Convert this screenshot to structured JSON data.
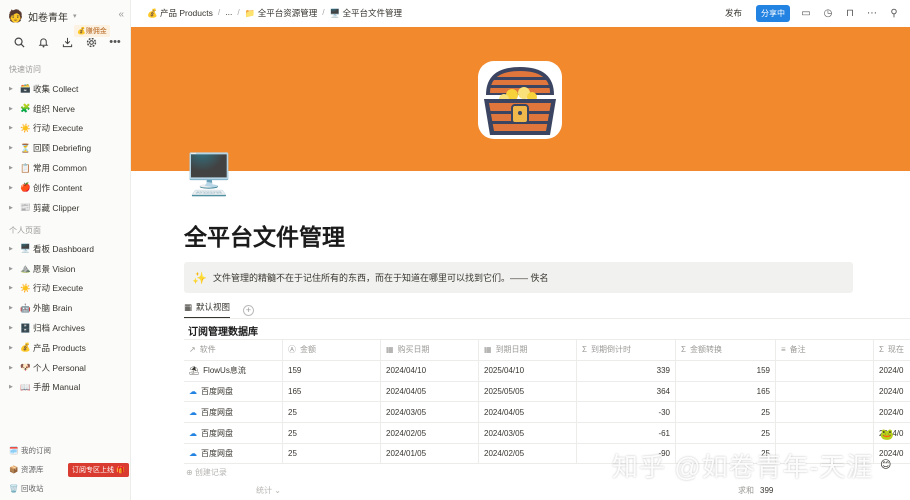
{
  "sidebar": {
    "workspace": {
      "avatar": "🧑",
      "name": "如卷青年"
    },
    "earn_badge": "💰赚佣金",
    "tools": [
      "search-icon",
      "bell-icon",
      "download-icon",
      "gear-icon",
      "more-icon"
    ],
    "section_quick": "快速访问",
    "quick": [
      {
        "icon": "🗃️",
        "label": "收集 Collect"
      },
      {
        "icon": "🧩",
        "label": "组织 Nerve"
      },
      {
        "icon": "☀️",
        "label": "行动 Execute"
      },
      {
        "icon": "⏳",
        "label": "回顾 Debriefing"
      },
      {
        "icon": "📋",
        "label": "常用 Common"
      },
      {
        "icon": "🍎",
        "label": "创作 Content"
      },
      {
        "icon": "📰",
        "label": "剪藏 Clipper"
      }
    ],
    "section_personal": "个人页面",
    "personal": [
      {
        "icon": "🖥️",
        "label": "看板 Dashboard"
      },
      {
        "icon": "⛰️",
        "label": "愿景 Vision"
      },
      {
        "icon": "☀️",
        "label": "行动 Execute"
      },
      {
        "icon": "🤖",
        "label": "外脑 Brain"
      },
      {
        "icon": "🗄️",
        "label": "归档 Archives"
      },
      {
        "icon": "💰",
        "label": "产品 Products"
      },
      {
        "icon": "🐶",
        "label": "个人 Personal"
      },
      {
        "icon": "📖",
        "label": "手册 Manual"
      }
    ],
    "footer": [
      {
        "icon": "🗓️",
        "label": "我的订阅"
      },
      {
        "icon": "📦",
        "label": "资源库"
      },
      {
        "icon": "🗑️",
        "label": "回收站"
      }
    ],
    "online_badge": "订阅专区上线 🎁"
  },
  "topbar": {
    "crumbs": [
      {
        "icon": "💰",
        "label": "产品 Products"
      },
      {
        "icon": "",
        "label": "..."
      },
      {
        "icon": "📁",
        "label": "全平台资源管理"
      },
      {
        "icon": "🖥️",
        "label": "全平台文件管理"
      }
    ],
    "publish": "发布",
    "share": "分享中"
  },
  "page": {
    "icon": "🖥️",
    "title": "全平台文件管理",
    "callout_icon": "✨",
    "callout": "文件管理的精髓不在于记住所有的东西，而在于知道在哪里可以找到它们。—— 佚名",
    "view_tab": "默认视图",
    "db_title": "订阅管理数据库"
  },
  "table": {
    "headers": [
      {
        "icon": "↗",
        "label": "软件"
      },
      {
        "icon": "Ⓐ",
        "label": "金额"
      },
      {
        "icon": "▦",
        "label": "购买日期"
      },
      {
        "icon": "▦",
        "label": "到期日期"
      },
      {
        "icon": "Σ",
        "label": "到期倒计时"
      },
      {
        "icon": "Σ",
        "label": "金额转换"
      },
      {
        "icon": "≡",
        "label": "备注"
      },
      {
        "icon": "Σ",
        "label": "现在"
      }
    ],
    "rows": [
      {
        "app": "FlowUs息流",
        "app_icon": "flowus",
        "amount": "159",
        "buy": "2024/04/10",
        "due": "2025/04/10",
        "countdown": "339",
        "convert": "159",
        "note": "",
        "now": "2024/0"
      },
      {
        "app": "百度网盘",
        "app_icon": "baidu",
        "amount": "165",
        "buy": "2024/04/05",
        "due": "2025/05/05",
        "countdown": "364",
        "convert": "165",
        "note": "",
        "now": "2024/0"
      },
      {
        "app": "百度网盘",
        "app_icon": "baidu",
        "amount": "25",
        "buy": "2024/03/05",
        "due": "2024/04/05",
        "countdown": "-30",
        "convert": "25",
        "note": "",
        "now": "2024/0"
      },
      {
        "app": "百度网盘",
        "app_icon": "baidu",
        "amount": "25",
        "buy": "2024/02/05",
        "due": "2024/03/05",
        "countdown": "-61",
        "convert": "25",
        "note": "",
        "now": "2024/0"
      },
      {
        "app": "百度网盘",
        "app_icon": "baidu",
        "amount": "25",
        "buy": "2024/01/05",
        "due": "2024/02/05",
        "countdown": "-90",
        "convert": "25",
        "note": "",
        "now": "2024/0"
      }
    ],
    "new_row": "⊕ 创建记录",
    "calc": "统计 ⌄",
    "sum_label": "求和",
    "sum_value": "399"
  },
  "watermark": "知乎 @如卷青年-天涯",
  "colors": {
    "cover": "#f2892d",
    "share": "#2383e2",
    "online": "#d93b30"
  }
}
